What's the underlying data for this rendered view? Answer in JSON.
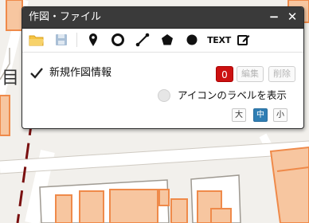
{
  "window": {
    "title": "作図・ファイル",
    "minimize_icon": "minus-icon",
    "close_icon": "close-icon"
  },
  "toolbar": {
    "tools": [
      {
        "name": "open-folder",
        "icon": "folder-icon"
      },
      {
        "name": "save",
        "icon": "floppy-disk-icon"
      },
      {
        "name": "point",
        "icon": "map-pin-icon"
      },
      {
        "name": "circle",
        "icon": "circle-icon"
      },
      {
        "name": "line",
        "icon": "line-icon"
      },
      {
        "name": "polygon",
        "icon": "pentagon-icon"
      },
      {
        "name": "dot",
        "icon": "filled-circle-icon"
      },
      {
        "name": "text",
        "label": "TEXT"
      },
      {
        "name": "edit",
        "icon": "edit-icon"
      }
    ]
  },
  "drawing": {
    "title": "新規作図情報",
    "checked": true,
    "count": "0",
    "edit_label": "編集",
    "delete_label": "削除"
  },
  "label_option": {
    "text": "アイコンのラベルを表示",
    "checked": false
  },
  "size": {
    "options": [
      "大",
      "中",
      "小"
    ],
    "selected": "中"
  },
  "colors": {
    "title_bar": "#3a3a3a",
    "count_badge": "#cc1111",
    "size_selected": "#2f7eb4",
    "map_building_fill": "#f7c6a0",
    "map_building_stroke": "#ef8a4a",
    "map_rail": "#7a1010"
  }
}
